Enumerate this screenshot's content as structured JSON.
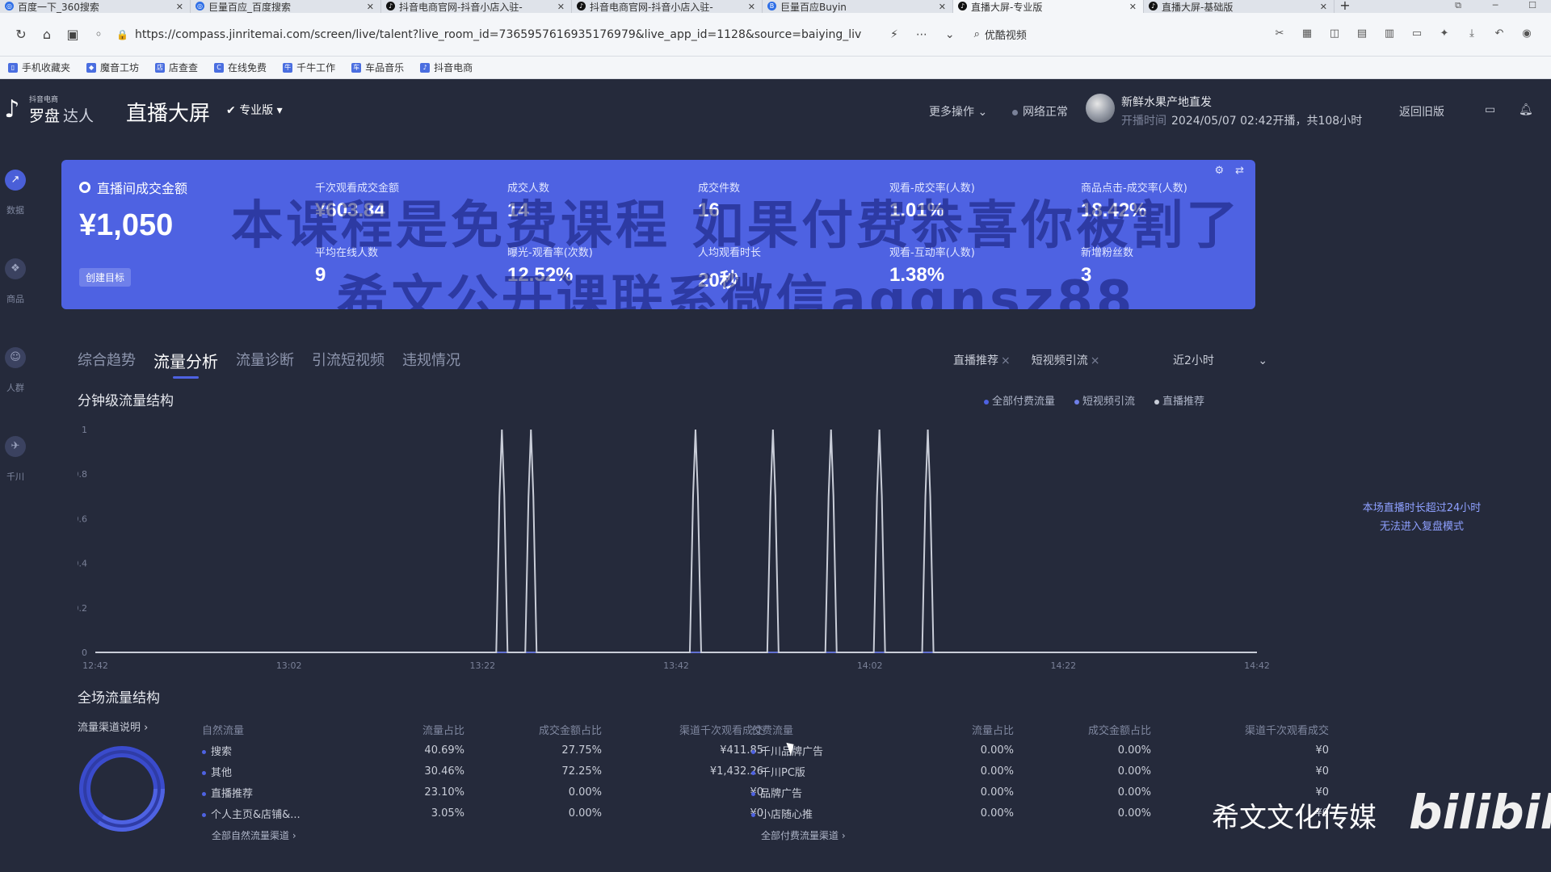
{
  "browser": {
    "tabs": [
      {
        "title": "百度一下_360搜索",
        "active": false
      },
      {
        "title": "巨量百应_百度搜索",
        "active": false
      },
      {
        "title": "抖音电商官网-抖音小店入驻-",
        "active": false
      },
      {
        "title": "抖音电商官网-抖音小店入驻-",
        "active": false
      },
      {
        "title": "巨量百应Buyin",
        "active": false
      },
      {
        "title": "直播大屏-专业版",
        "active": true
      },
      {
        "title": "直播大屏-基础版",
        "active": false
      }
    ],
    "url": "https://compass.jinritemai.com/screen/live/talent?live_room_id=7365957616935176979&live_app_id=1128&source=baiying_liv",
    "search_label": "优酷视频",
    "bookmarks": [
      "手机收藏夹",
      "魔音工坊",
      "店查查",
      "在线免费",
      "千牛工作",
      "车品音乐",
      "抖音电商"
    ]
  },
  "header": {
    "logo_sub": "抖音电商",
    "logo_main": "罗盘",
    "logo_role": "达人",
    "title": "直播大屏",
    "edition": "专业版",
    "more_ops": "更多操作",
    "network": "网络正常",
    "shop_name": "新鲜水果产地直发",
    "time_label": "开播时间",
    "time_value": "2024/05/07 02:42开播，共108小时",
    "back_old": "返回旧版"
  },
  "sidenav": [
    {
      "label": "数据",
      "icon": "chart-icon",
      "active": true
    },
    {
      "label": "商品",
      "icon": "goods-icon",
      "active": false
    },
    {
      "label": "人群",
      "icon": "people-icon",
      "active": false
    },
    {
      "label": "千川",
      "icon": "qianchuan-icon",
      "active": false
    }
  ],
  "kpi": {
    "main_label": "直播间成交金额",
    "main_value": "¥1,050",
    "target_label": "创建目标",
    "metrics": [
      {
        "label": "千次观看成交金额",
        "value": "¥603.84"
      },
      {
        "label": "成交人数",
        "value": "14"
      },
      {
        "label": "成交件数",
        "value": "16"
      },
      {
        "label": "观看-成交率(人数)",
        "value": "1.01%"
      },
      {
        "label": "商品点击-成交率(人数)",
        "value": "18.42%"
      },
      {
        "label": "平均在线人数",
        "value": "9"
      },
      {
        "label": "曝光-观看率(次数)",
        "value": "12.52%"
      },
      {
        "label": "人均观看时长",
        "value": "20秒"
      },
      {
        "label": "观看-互动率(人数)",
        "value": "1.38%"
      },
      {
        "label": "新增粉丝数",
        "value": "3"
      }
    ],
    "watermark_line1": "本课程是免费课程 如果付费恭喜你被割了",
    "watermark_line2": "希文公开课联系微信aqgnsz88"
  },
  "tabs": [
    "综合趋势",
    "流量分析",
    "流量诊断",
    "引流短视频",
    "违规情况"
  ],
  "active_tab": "流量分析",
  "filters": [
    "直播推荐",
    "短视频引流"
  ],
  "time_range": "近2小时",
  "side_note": [
    "本场直播时长超过24小时",
    "无法进入复盘模式"
  ],
  "chart_data": {
    "type": "line",
    "title": "分钟级流量结构",
    "x_ticks": [
      "12:42",
      "13:02",
      "13:22",
      "13:42",
      "14:02",
      "14:22",
      "14:42"
    ],
    "y_ticks": [
      "0",
      "0.2",
      "0.4",
      "0.6",
      "0.8",
      "1"
    ],
    "ylim": [
      0,
      1
    ],
    "series": [
      {
        "name": "全部付费流量",
        "color": "#4e62e2",
        "peaks": []
      },
      {
        "name": "短视频引流",
        "color": "#6f7fe8",
        "peaks": []
      },
      {
        "name": "直播推荐",
        "color": "#c9cdd8",
        "peaks": [
          13.24,
          13.27,
          13.44,
          13.52,
          13.58,
          14.03,
          14.08
        ]
      }
    ],
    "legend_position": "top-right"
  },
  "flow_section": {
    "title": "全场流量结构",
    "channel_note": "流量渠道说明",
    "natural": {
      "headers": [
        "自然流量",
        "流量占比",
        "成交金额占比",
        "渠道千次观看成交"
      ],
      "rows": [
        [
          "搜索",
          "40.69%",
          "27.75%",
          "¥411.85"
        ],
        [
          "其他",
          "30.46%",
          "72.25%",
          "¥1,432.26"
        ],
        [
          "直播推荐",
          "23.10%",
          "0.00%",
          "¥0"
        ],
        [
          "个人主页&店铺&...",
          "3.05%",
          "0.00%",
          "¥0"
        ]
      ],
      "more": "全部自然流量渠道"
    },
    "paid": {
      "headers": [
        "付费流量",
        "流量占比",
        "成交金额占比",
        "渠道千次观看成交"
      ],
      "rows": [
        [
          "千川品牌广告",
          "0.00%",
          "0.00%",
          "¥0"
        ],
        [
          "千川PC版",
          "0.00%",
          "0.00%",
          "¥0"
        ],
        [
          "品牌广告",
          "0.00%",
          "0.00%",
          "¥0"
        ],
        [
          "小店随心推",
          "0.00%",
          "0.00%",
          "¥0"
        ]
      ],
      "more": "全部付费流量渠道"
    }
  },
  "brand_text": "希文文化传媒",
  "brand_logo": "bilibili"
}
